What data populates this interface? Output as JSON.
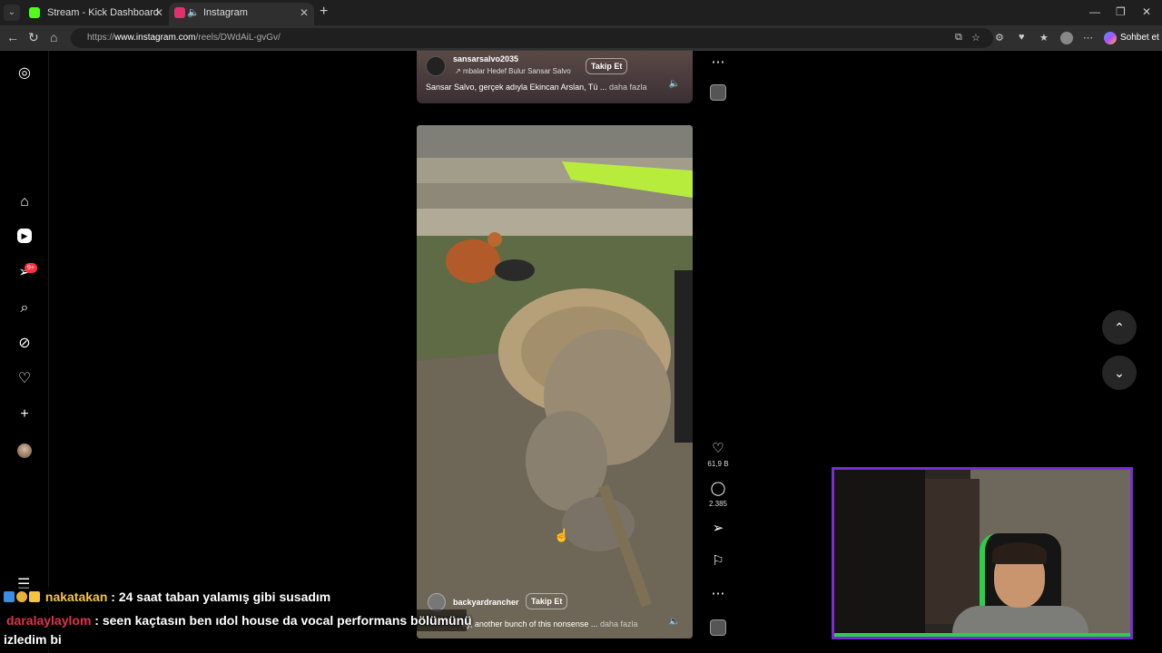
{
  "browser": {
    "tabs": [
      {
        "title": "Stream - Kick Dashboard",
        "favicon_color": "#53fc18",
        "active": false
      },
      {
        "title": "Instagram",
        "favicon_color": "#e1306c",
        "active": true
      }
    ],
    "url_prefix": "https://",
    "url_host": "www.instagram.com",
    "url_path": "/reels/DWdAiL-gvGv/",
    "copilot_label": "Sohbet et"
  },
  "sidebar": {
    "items": [
      {
        "name": "instagram-logo-icon"
      },
      {
        "name": "home-icon"
      },
      {
        "name": "reels-icon"
      },
      {
        "name": "direct-messages-icon"
      },
      {
        "name": "search-icon"
      },
      {
        "name": "explore-icon"
      },
      {
        "name": "notifications-heart-icon"
      },
      {
        "name": "create-plus-icon"
      },
      {
        "name": "profile-avatar"
      },
      {
        "name": "more-menu-icon"
      }
    ],
    "messages_badge": "9+"
  },
  "previous_reel": {
    "username": "sansarsalvo2035",
    "audio": "mbalar Hedef Bulur  Sansar Salvo",
    "follow_label": "Takip Et",
    "caption": "Sansar Salvo, gerçek adıyla Ekincan Arslan, Tü ...",
    "more_label": "daha fazla"
  },
  "current_reel": {
    "username": "backyardrancher",
    "follow_label": "Takip Et",
    "caption": "ay, another bunch of this nonsense ...",
    "more_label": "daha fazla",
    "likes": "61,9 B",
    "comments": "2.385"
  },
  "chat": [
    {
      "user": "nakatakan",
      "message": ": 24 saat taban yalamış gibi susadım"
    },
    {
      "user": "daralaylaylom",
      "message": ": seen kaçtasın ben ıdol house da vocal performans bölümünü"
    },
    {
      "user": "",
      "message": "izledim bi"
    }
  ],
  "colors": {
    "accent_purple": "#7a2bd6",
    "accent_green": "#2ccf4b",
    "badge_red": "#ff3040"
  }
}
